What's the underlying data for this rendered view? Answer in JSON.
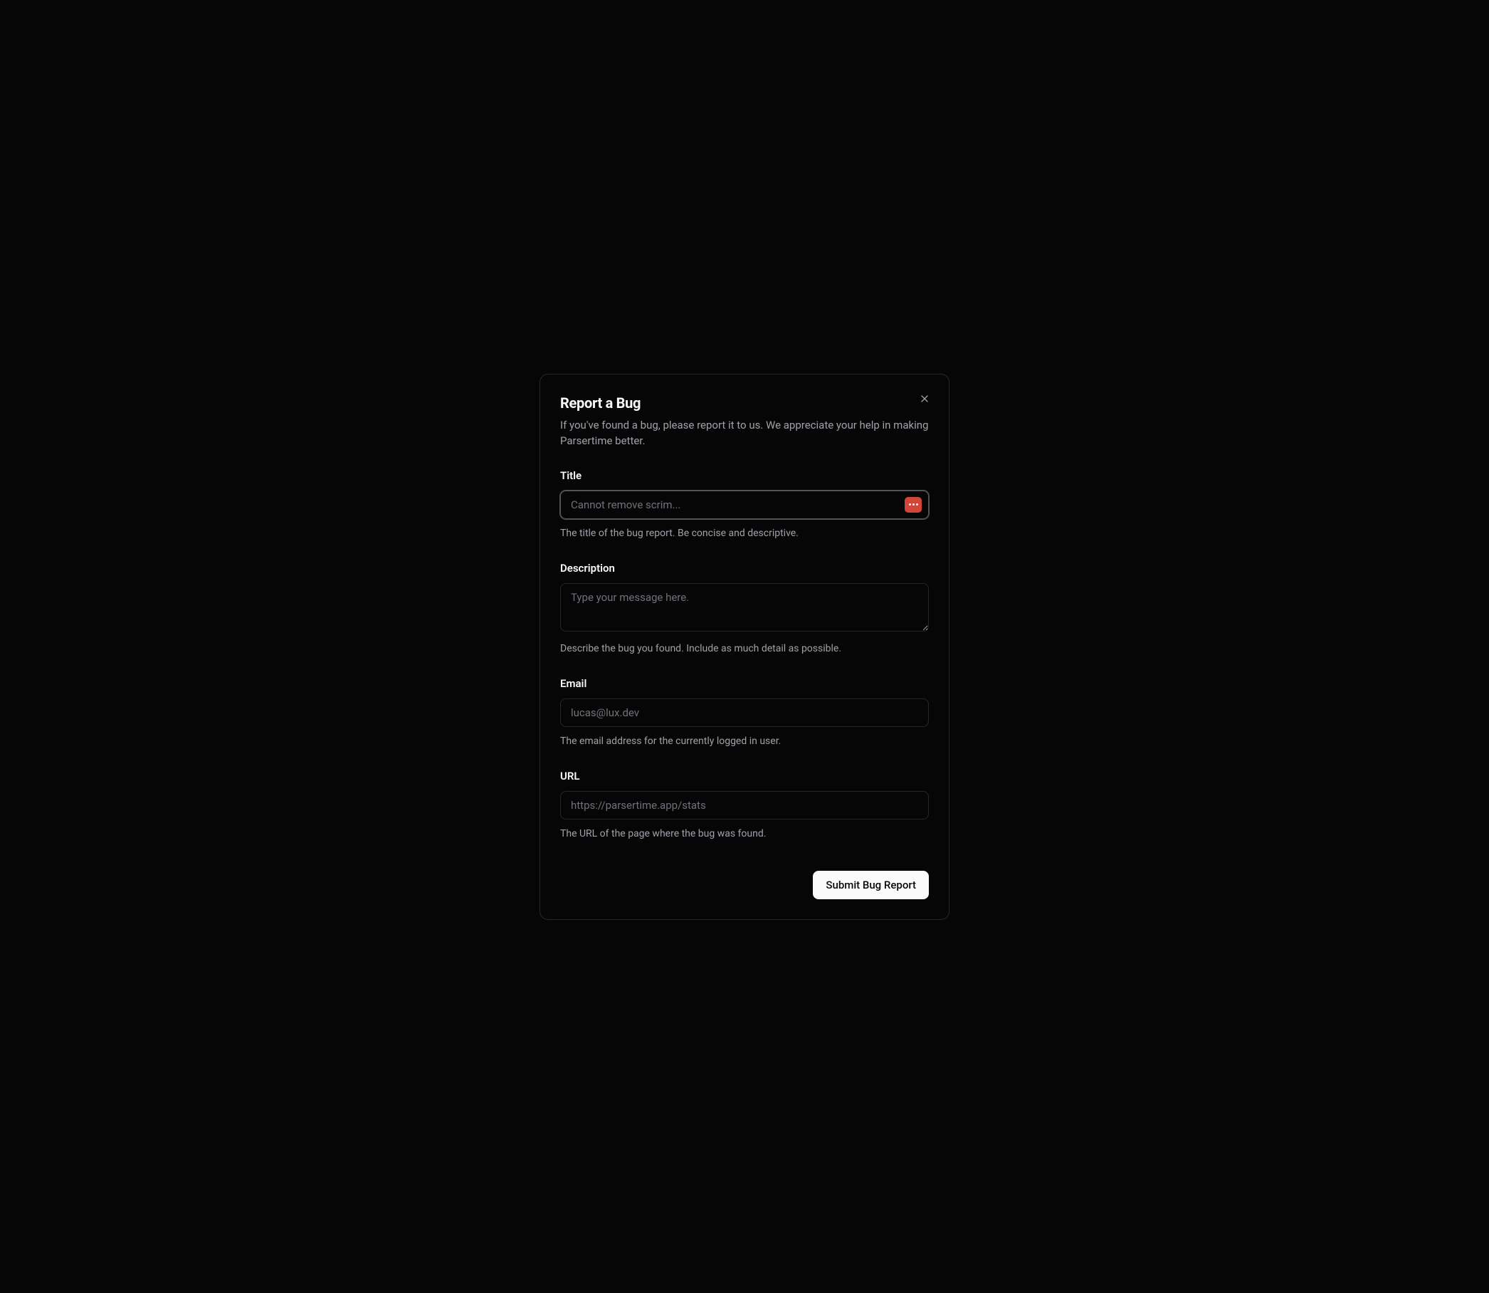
{
  "modal": {
    "title": "Report a Bug",
    "subtitle": "If you've found a bug, please report it to us. We appreciate your help in making Parsertime better."
  },
  "form": {
    "title": {
      "label": "Title",
      "placeholder": "Cannot remove scrim...",
      "help": "The title of the bug report. Be concise and descriptive."
    },
    "description": {
      "label": "Description",
      "placeholder": "Type your message here.",
      "help": "Describe the bug you found. Include as much detail as possible."
    },
    "email": {
      "label": "Email",
      "placeholder": "lucas@lux.dev",
      "help": "The email address for the currently logged in user."
    },
    "url": {
      "label": "URL",
      "placeholder": "https://parsertime.app/stats",
      "help": "The URL of the page where the bug was found."
    },
    "submit_label": "Submit Bug Report"
  }
}
